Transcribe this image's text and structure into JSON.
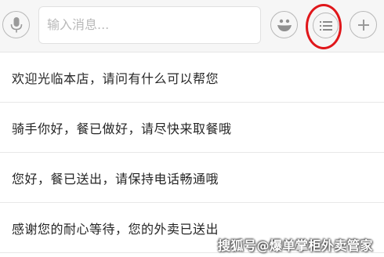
{
  "toolbar": {
    "input_placeholder": "输入消息...",
    "icons": {
      "voice": "microphone-icon",
      "emoji": "smiley-icon",
      "quick_reply": "list-icon",
      "more": "plus-icon"
    },
    "highlight_color": "#e0171b"
  },
  "quick_replies": [
    {
      "text": "欢迎光临本店，请问有什么可以帮您"
    },
    {
      "text": "骑手你好，餐已做好，请尽快来取餐哦"
    },
    {
      "text": "您好，餐已送出，请保持电话畅通哦"
    },
    {
      "text": "感谢您的耐心等待，您的外卖已送出"
    }
  ],
  "watermark": "搜狐号@爆单掌柜外卖管家"
}
